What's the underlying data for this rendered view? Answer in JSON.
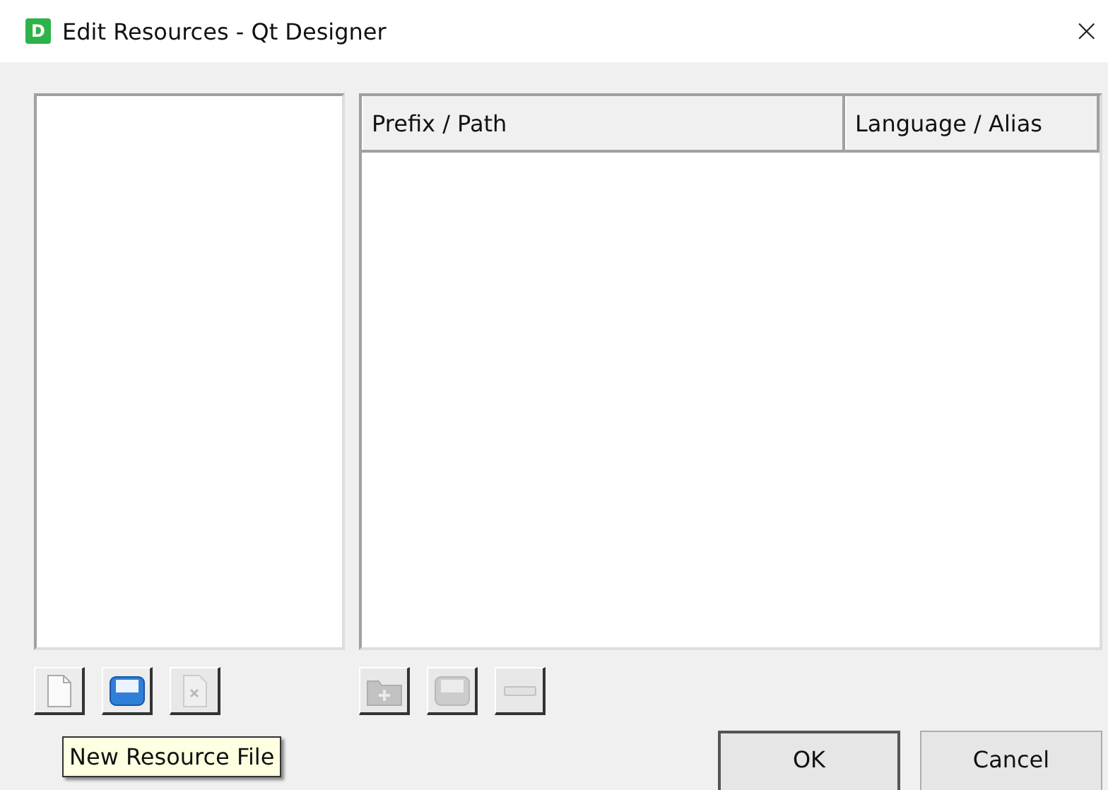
{
  "window": {
    "title": "Edit Resources - Qt Designer",
    "app_icon": "D",
    "close": "×"
  },
  "table": {
    "columns": [
      "Prefix / Path",
      "Language / Alias"
    ]
  },
  "file_tools": [
    {
      "kind": "new",
      "disabled": false
    },
    {
      "kind": "save",
      "disabled": false
    },
    {
      "kind": "remove",
      "disabled": true
    }
  ],
  "resource_tools": [
    {
      "kind": "add-folder",
      "disabled": true
    },
    {
      "kind": "save",
      "disabled": true
    },
    {
      "kind": "minus",
      "disabled": true
    }
  ],
  "tooltip": "New Resource File",
  "buttons": [
    {
      "label": "OK",
      "default": true
    },
    {
      "label": "Cancel",
      "default": false
    }
  ]
}
